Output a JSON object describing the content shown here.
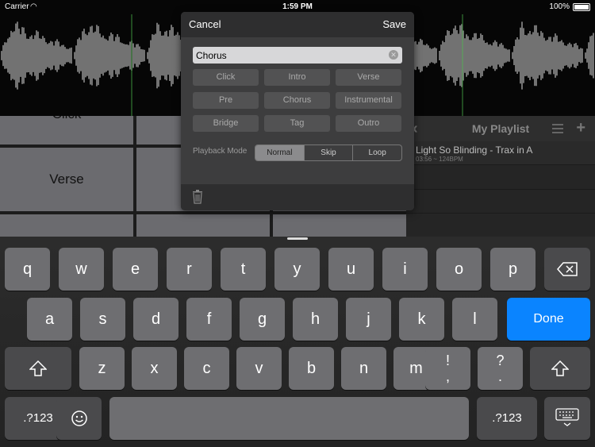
{
  "status_bar": {
    "carrier": "Carrier",
    "time": "1:59 PM",
    "battery": "100%"
  },
  "pads": {
    "top_label": "Click",
    "mid_label": "Verse"
  },
  "playlist": {
    "title": "My Playlist",
    "items": [
      {
        "title": "Light So Blinding - Trax in A",
        "subtitle": "03:56 ~ 124BPM"
      }
    ]
  },
  "dialog": {
    "cancel_label": "Cancel",
    "save_label": "Save",
    "name_value": "Chorus",
    "tags": [
      "Click",
      "Intro",
      "Verse",
      "Pre",
      "Chorus",
      "Instrumental",
      "Bridge",
      "Tag",
      "Outro"
    ],
    "playback_mode_label": "Playback Mode",
    "playback_modes": [
      "Normal",
      "Skip",
      "Loop"
    ],
    "selected_mode": "Normal"
  },
  "keyboard": {
    "row1": [
      "q",
      "w",
      "e",
      "r",
      "t",
      "y",
      "u",
      "i",
      "o",
      "p"
    ],
    "row2": [
      "a",
      "s",
      "d",
      "f",
      "g",
      "h",
      "j",
      "k",
      "l"
    ],
    "row3": [
      "z",
      "x",
      "c",
      "v",
      "b",
      "n",
      "m"
    ],
    "done_label": "Done",
    "punct1": "!\n,",
    "punct2": "?\n.",
    "numbers_label": ".?123"
  },
  "colors": {
    "accent": "#0a84ff"
  }
}
